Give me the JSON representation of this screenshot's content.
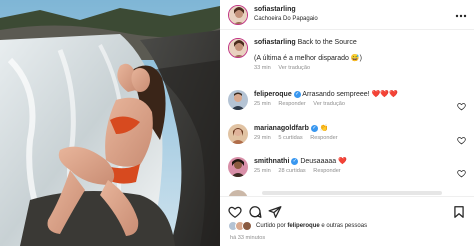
{
  "post": {
    "username": "sofiastarling",
    "location": "Cachoeira Do Papagaio",
    "caption_user": "sofiastarling",
    "caption_text": "Back to the Source",
    "caption_text2": "(A última é a melhor disparado 😅)",
    "caption_time": "33 min",
    "caption_translate": "Ver tradução"
  },
  "comments": [
    {
      "user": "feliperoque",
      "verified": true,
      "text": "Arrasando sempreee! ❤️❤️❤️",
      "time": "25 min",
      "likes": "",
      "reply": "Responder",
      "translate": "Ver tradução"
    },
    {
      "user": "marianagoldfarb",
      "verified": true,
      "text": "👏",
      "time": "29 min",
      "likes": "5 curtidas",
      "reply": "Responder",
      "translate": ""
    },
    {
      "user": "smithnathi",
      "verified": true,
      "text": "Deusaaaaa ❤️",
      "time": "25 min",
      "likes": "28 curtidas",
      "reply": "Responder",
      "translate": ""
    }
  ],
  "footer": {
    "liked_prefix": "Curtido por ",
    "liked_user": "feliperoque",
    "liked_suffix": " e outras pessoas",
    "time_ago": "há 33 minutos"
  },
  "icons": {
    "like": "heart-icon",
    "comment": "comment-icon",
    "share": "share-icon",
    "save": "bookmark-icon",
    "more": "more-options-icon"
  }
}
